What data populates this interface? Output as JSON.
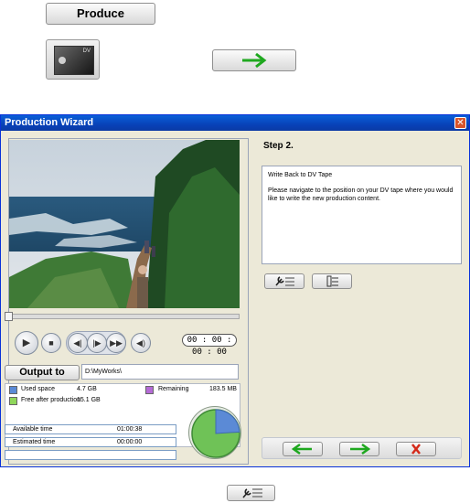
{
  "top": {
    "produce_label": "Produce",
    "dv_icon_label": "DV"
  },
  "dialog": {
    "title": "Production Wizard",
    "close_glyph": "✕",
    "step_title": "Step 2.",
    "description_title": "Write Back to DV Tape",
    "description_body": "Please navigate to the position on your DV tape where you would like to write the new production content.",
    "timecode": "00 : 00 : 00 : 00",
    "output_label": "Output to",
    "output_path": "D:\\MyWorks\\",
    "used_space_label": "Used space",
    "used_space_value": "4.7  GB",
    "remaining_label": "Remaining",
    "remaining_value": "183.5  MB",
    "free_after_label": "Free after production",
    "free_after_value": "15.1  GB",
    "available_time_label": "Available time",
    "available_time_value": "01:00:38",
    "estimated_time_label": "Estimated time",
    "estimated_time_value": "00:00:00",
    "colors": {
      "used": "#5b8ad6",
      "remaining": "#b56bd6",
      "free": "#8fd65b",
      "next_arrow": "#1fa81f",
      "back_arrow": "#1fa81f",
      "cancel_x": "#d42a1a"
    },
    "disk_usage": {
      "used_fraction": 0.24,
      "free_fraction": 0.76
    },
    "controls": [
      "play",
      "stop",
      "prev-frame",
      "next-frame",
      "fast-forward",
      "volume"
    ]
  },
  "icons": {
    "tools": "wrench-list-icon",
    "chapters": "chapter-list-icon",
    "next": "arrow-right-icon",
    "back": "arrow-left-icon",
    "cancel": "x-icon"
  }
}
